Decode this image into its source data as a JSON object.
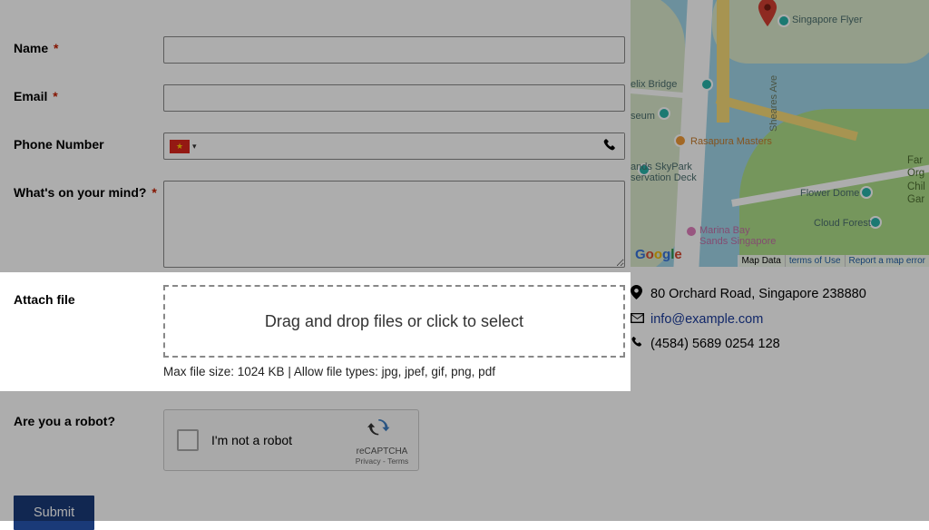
{
  "form": {
    "name_label": "Name",
    "email_label": "Email",
    "phone_label": "Phone Number",
    "message_label": "What's on your mind?",
    "attach_label": "Attach file",
    "dropzone_text": "Drag and drop files or click to select",
    "attach_hint": "Max file size: 1024 KB | Allow file types: jpg, jpef, gif, png, pdf",
    "robot_label": "Are you a robot?",
    "recaptcha_text": "I'm not a robot",
    "recaptcha_brand": "reCAPTCHA",
    "recaptcha_terms": "Privacy - Terms",
    "submit_label": "Submit",
    "required_mark": "*"
  },
  "contact": {
    "address": "80 Orchard Road, Singapore 238880",
    "email": "info@example.com",
    "phone": "(4584) 5689 0254 128"
  },
  "map": {
    "poi": {
      "flyer": "Singapore Flyer",
      "bridge": "elix Bridge",
      "museum": "seum",
      "rasapura": "Rasapura Masters",
      "skypark": "ands SkyPark\nservation Deck",
      "shearers": "Sheares Ave",
      "flower": "Flower Dome",
      "cloud": "Cloud Forest",
      "marina": "Marina Bay\nSands Singapore",
      "garden_cut": "Far\nOrg\nChil\nGar"
    },
    "google": "Google",
    "footer": {
      "mapdata": "Map Data",
      "terms": "terms of Use",
      "report": "Report a map error"
    }
  }
}
